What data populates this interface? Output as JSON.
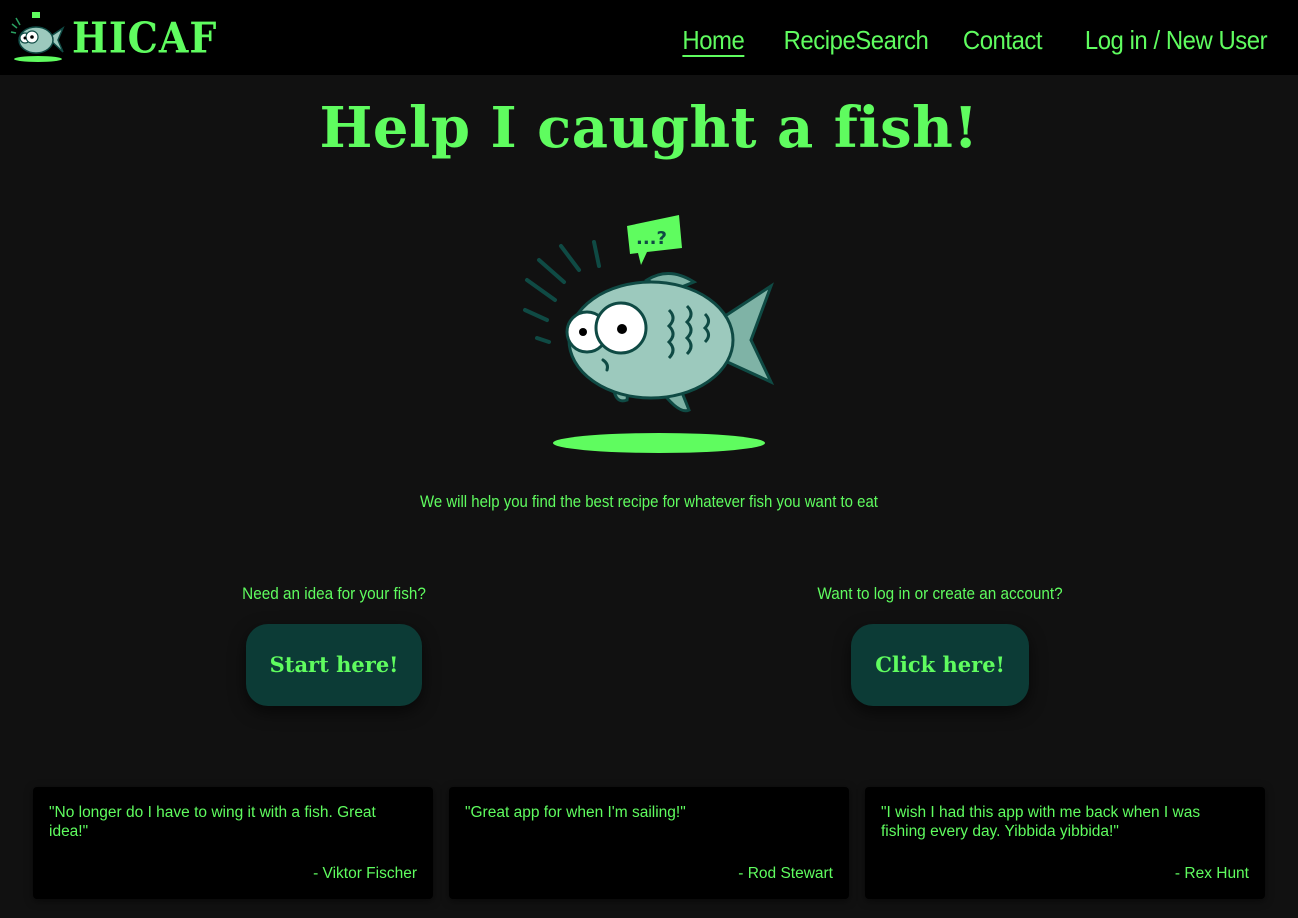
{
  "brand": {
    "name": "HICAF",
    "logo_icon": "fish-icon"
  },
  "nav": {
    "links": [
      {
        "label": "Home",
        "active": true
      },
      {
        "label": "RecipeSearch",
        "active": false
      },
      {
        "label": "Contact",
        "active": false
      },
      {
        "label": "Log in / New User",
        "active": false
      }
    ]
  },
  "hero": {
    "title": "Help I caught a fish!",
    "image_icon": "surprised-fish-icon",
    "bubble_text": "...?",
    "tagline": "We will help you find the best recipe for whatever fish you want to eat"
  },
  "cta": {
    "left": {
      "prompt": "Need an idea for your fish?",
      "button": "Start here!"
    },
    "right": {
      "prompt": "Want to log in or create an account?",
      "button": "Click here!"
    }
  },
  "testimonials": [
    {
      "quote": "\"No longer do I have to wing it with a fish. Great idea!\"",
      "author": "- Viktor Fischer"
    },
    {
      "quote": "\"Great app for when I'm sailing!\"",
      "author": "- Rod Stewart"
    },
    {
      "quote": "\"I wish I had this app with me back when I was fishing every day. Yibbida yibbida!\"",
      "author": "- Rex Hunt"
    }
  ],
  "colors": {
    "accent": "#5ffc5f",
    "background": "#111111",
    "navbar": "#000000",
    "button": "#0c3b36",
    "fish_body": "#9cc9bd",
    "fish_dark": "#0f4a44"
  }
}
